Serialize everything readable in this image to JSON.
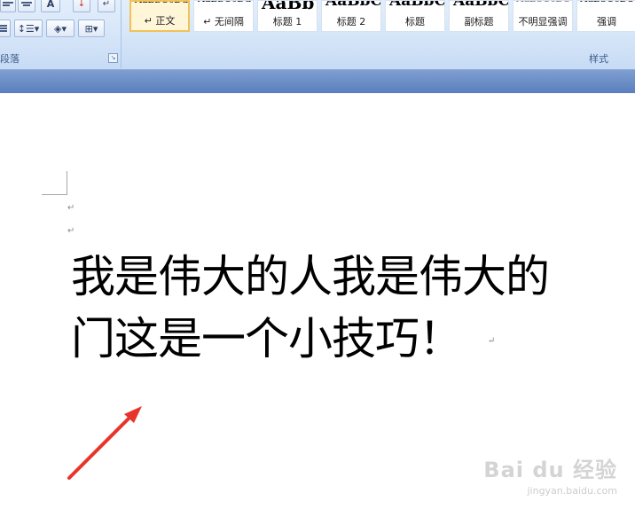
{
  "ribbon": {
    "paragraph_group_label": "段落",
    "styles_group_label": "样式",
    "styles": [
      {
        "sample": "AaBbCcDd",
        "name": "↵ 正文",
        "selected": true
      },
      {
        "sample": "AaBbCcDd",
        "name": "↵ 无间隔",
        "selected": false
      },
      {
        "sample": "AaBb",
        "name": "标题 1",
        "selected": false
      },
      {
        "sample": "AaBbC",
        "name": "标题 2",
        "selected": false
      },
      {
        "sample": "AaBbC",
        "name": "标题",
        "selected": false
      },
      {
        "sample": "AaBbC",
        "name": "副标题",
        "selected": false
      },
      {
        "sample": "AaBbCcDd",
        "name": "不明显强调",
        "selected": false
      },
      {
        "sample": "AaBbCcDd",
        "name": "强调",
        "selected": false
      }
    ]
  },
  "document": {
    "paragraph_mark": "↵",
    "line1": "我是伟大的人我是伟大的",
    "line2": "门这是一个小技巧！"
  },
  "watermark": {
    "logo": "Bai du 经验",
    "url": "jingyan.baidu.com"
  },
  "colors": {
    "ribbon_bg": "#d5e5f8",
    "band": "#6f90c8",
    "arrow": "#e8352b",
    "selected_style": "#f0c35a"
  }
}
